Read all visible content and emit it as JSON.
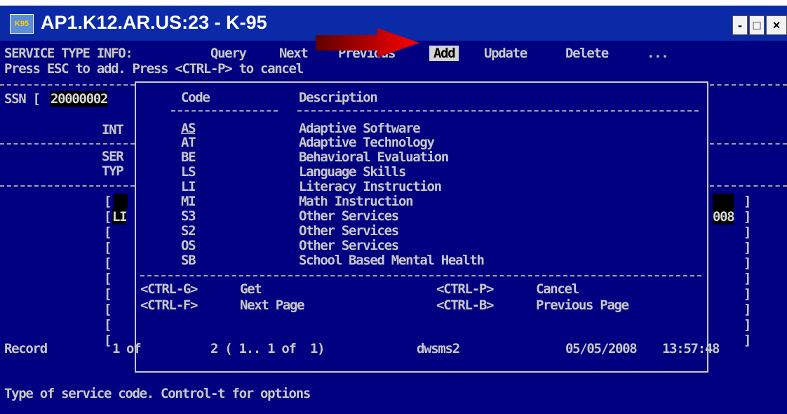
{
  "window": {
    "title": "AP1.K12.AR.US:23 - K-95",
    "icon_label": "K95",
    "min_label": "-",
    "max_label": "□",
    "close_label": "×"
  },
  "menu": {
    "label": "SERVICE TYPE INFO:",
    "items": [
      "Query",
      "Next",
      "Previous",
      "Add",
      "Update",
      "Delete",
      "..."
    ],
    "selected": "Add",
    "instruction": "Press ESC to add. Press <CTRL-P> to cancel"
  },
  "form": {
    "ssn_label": "SSN [",
    "ssn_value": "20000002",
    "int_label": "INT",
    "ser_label": "SER",
    "typ_label": "TYP",
    "row_open": "[",
    "row_close": "]",
    "service_value": "LI",
    "right_value": "008"
  },
  "popup": {
    "code_header": "Code",
    "description_header": "Description",
    "items": [
      {
        "code": "AS",
        "description": "Adaptive Software"
      },
      {
        "code": "AT",
        "description": "Adaptive Technology"
      },
      {
        "code": "BE",
        "description": "Behavioral Evaluation"
      },
      {
        "code": "LS",
        "description": "Language Skills"
      },
      {
        "code": "LI",
        "description": "Literacy Instruction"
      },
      {
        "code": "MI",
        "description": "Math Instruction"
      },
      {
        "code": "S3",
        "description": "Other Services"
      },
      {
        "code": "S2",
        "description": "Other Services"
      },
      {
        "code": "OS",
        "description": "Other Services"
      },
      {
        "code": "SB",
        "description": "School Based Mental Health"
      }
    ],
    "keys": {
      "get_key": "<CTRL-G>",
      "get_label": "Get",
      "next_key": "<CTRL-F>",
      "next_label": "Next Page",
      "cancel_key": "<CTRL-P>",
      "cancel_label": "Cancel",
      "prev_key": "<CTRL-B>",
      "prev_label": "Previous Page"
    }
  },
  "status": {
    "record_label": "Record",
    "record_num": "1",
    "of_label": "of",
    "record_total": "2 ( 1.. 1 of  1)",
    "user": "dwsms2",
    "date": "05/05/2008",
    "time": "13:57:48"
  },
  "help_text": "Type of service code. Control-t for options",
  "colors": {
    "terminal_bg": "#000080",
    "titlebar_bg": "#0a2aa8",
    "text": "#c8c8c8",
    "arrow": "#e00000"
  }
}
